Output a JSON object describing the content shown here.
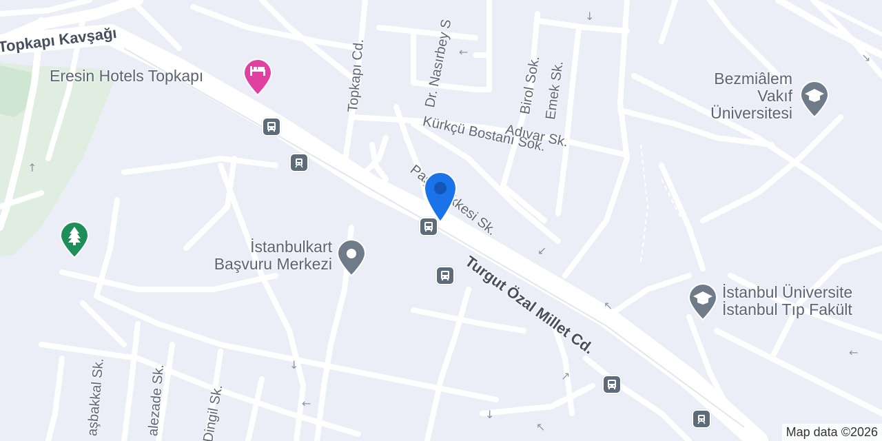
{
  "map": {
    "streets": [
      {
        "id": "topkapi-kavsagi",
        "text": "Topkapı Kavşağı"
      },
      {
        "id": "topkapi-cd",
        "text": "Topkapı Cd."
      },
      {
        "id": "dr-nasirbey",
        "text": "Dr. Nasırbey S"
      },
      {
        "id": "birol-sok",
        "text": "Birol Sok."
      },
      {
        "id": "emek-sk",
        "text": "Emek Sk."
      },
      {
        "id": "kurkcu-bostani",
        "text": "Kürkçü Bostanı Sok."
      },
      {
        "id": "adivar-sk",
        "text": "Adıvar Sk."
      },
      {
        "id": "pasa-tekkesi",
        "text": "Paşa Tekkesi Sk."
      },
      {
        "id": "turgut-ozal",
        "text": "Turgut Özal Millet Cd."
      },
      {
        "id": "basbakkal",
        "text": "aşbakkal Sk."
      },
      {
        "id": "alezade",
        "text": "alezade Sk."
      },
      {
        "id": "dingil",
        "text": "Dingil Sk."
      }
    ],
    "places": [
      {
        "id": "eresin",
        "text": "Eresin Hotels Topkapı",
        "icon": "hotel-icon",
        "color": "#e040a0"
      },
      {
        "id": "bezmialem",
        "text": "Bezmiâlem\nVakıf\nÜniversitesi",
        "icon": "university-icon",
        "color": "#6f7b89"
      },
      {
        "id": "istanbulkart",
        "text": "İstanbulkart\nBaşvuru Merkezi",
        "icon": "place-icon",
        "color": "#6f7b89"
      },
      {
        "id": "tip-fakultesi",
        "text": "İstanbul Üniversite\nİstanbul Tıp Fakült",
        "icon": "university-icon",
        "color": "#6f7b89"
      },
      {
        "id": "park",
        "text": "",
        "icon": "tree-icon",
        "color": "#1e8f5a"
      }
    ],
    "location_pin": {
      "icon": "map-pin-icon",
      "color": "#1a73e8"
    },
    "attribution": "Map data ©2026"
  }
}
